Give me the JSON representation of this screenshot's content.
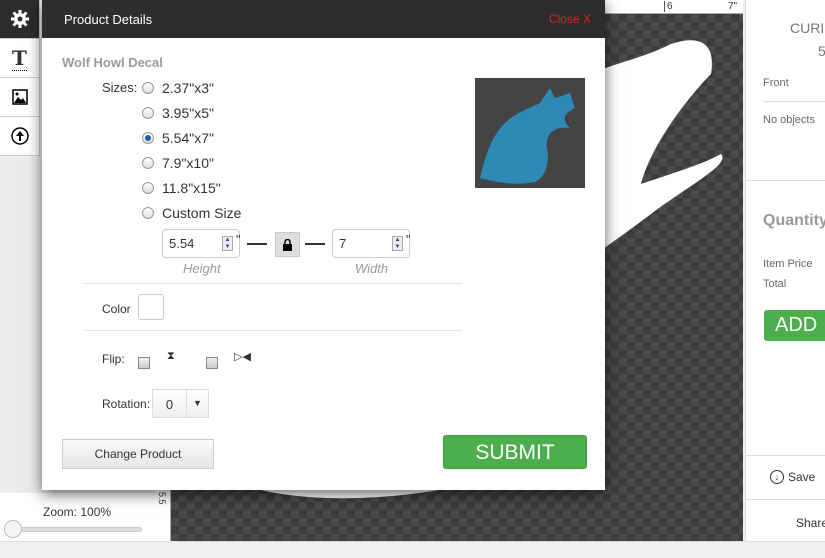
{
  "toolbar": {
    "items": [
      {
        "icon": "gear-icon"
      },
      {
        "icon": "text-icon"
      },
      {
        "icon": "image-icon"
      },
      {
        "icon": "upload-icon"
      }
    ]
  },
  "zoom": {
    "label": "Zoom: 100%",
    "value_percent": 100
  },
  "ruler": {
    "top_ticks": [
      "6",
      "7\""
    ],
    "side_label": "5.5"
  },
  "modal": {
    "title": "Product Details",
    "close": "Close X",
    "product_name": "Wolf Howl Decal",
    "sizes_label": "Sizes:",
    "sizes": [
      "2.37\"x3\"",
      "3.95\"x5\"",
      "5.54\"x7\"",
      "7.9\"x10\"",
      "11.8\"x15\"",
      "Custom Size"
    ],
    "selected_size": "5.54\"x7\"",
    "height": {
      "value": "5.54",
      "unit": "\"",
      "caption": "Height"
    },
    "width": {
      "value": "7",
      "unit": "\"",
      "caption": "Width"
    },
    "color_label": "Color",
    "color_value": "#ffffff",
    "flip_label": "Flip:",
    "rotation_label": "Rotation:",
    "rotation_value": "0",
    "change_product": "Change Product",
    "submit": "SUBMIT",
    "thumb_color": "#2e8ab5"
  },
  "right": {
    "cur": "CURI",
    "num": "5",
    "front": "Front",
    "no_objects": "No objects",
    "quantity": "Quantity:",
    "item_price": "Item Price",
    "total": "Total",
    "add": "ADD",
    "save": "Save",
    "share": "Share"
  }
}
